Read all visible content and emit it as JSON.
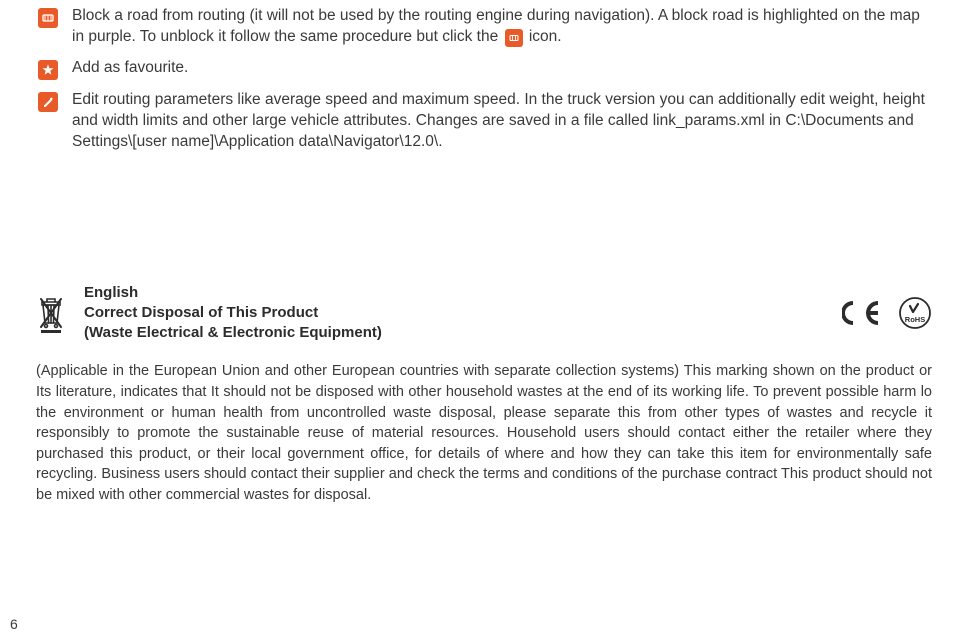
{
  "rows": [
    {
      "icon": "block-road-icon",
      "lead": "Block a road from routing (it will not be used by the routing engine during navigation). A block road is highlighted on the map in purple. To unblock it follow the same procedure but click the ",
      "inline_icon": "unblock-road-icon",
      "trail": " icon."
    },
    {
      "icon": "favourite-star-icon",
      "lead": "Add as favourite.",
      "inline_icon": null,
      "trail": ""
    },
    {
      "icon": "edit-params-icon",
      "lead": "Edit routing parameters like average speed and maximum speed. In the truck version you can additionally edit weight, height and width limits and other large vehicle attributes. Changes are saved in a file called link_params.xml in C:\\Documents and Settings\\[user name]\\Application data\\Navigator\\12.0\\.",
      "inline_icon": null,
      "trail": ""
    }
  ],
  "disposal": {
    "title1": "English",
    "title2": "Correct Disposal of This Product",
    "title3": "(Waste Electrical & Electronic Equipment)",
    "body": "(Applicable in the European Union and other European countries with separate collection systems) This marking shown on the product or Its literature, indicates that It should not be disposed with other household wastes at the end of its working life. To prevent possible harm lo the environment or human health from uncontrolled waste disposal, please separate this from other types of wastes and recycle it responsibly to promote the sustainable reuse of material resources. Household users should contact either the retailer where they purchased this product, or their local government office, for details of where and how they can take this item for environmentally safe recycling. Business users should contact their supplier and check the terms and conditions of the purchase contract This product should not be mixed with other commercial wastes for disposal."
  },
  "page_number": "6"
}
